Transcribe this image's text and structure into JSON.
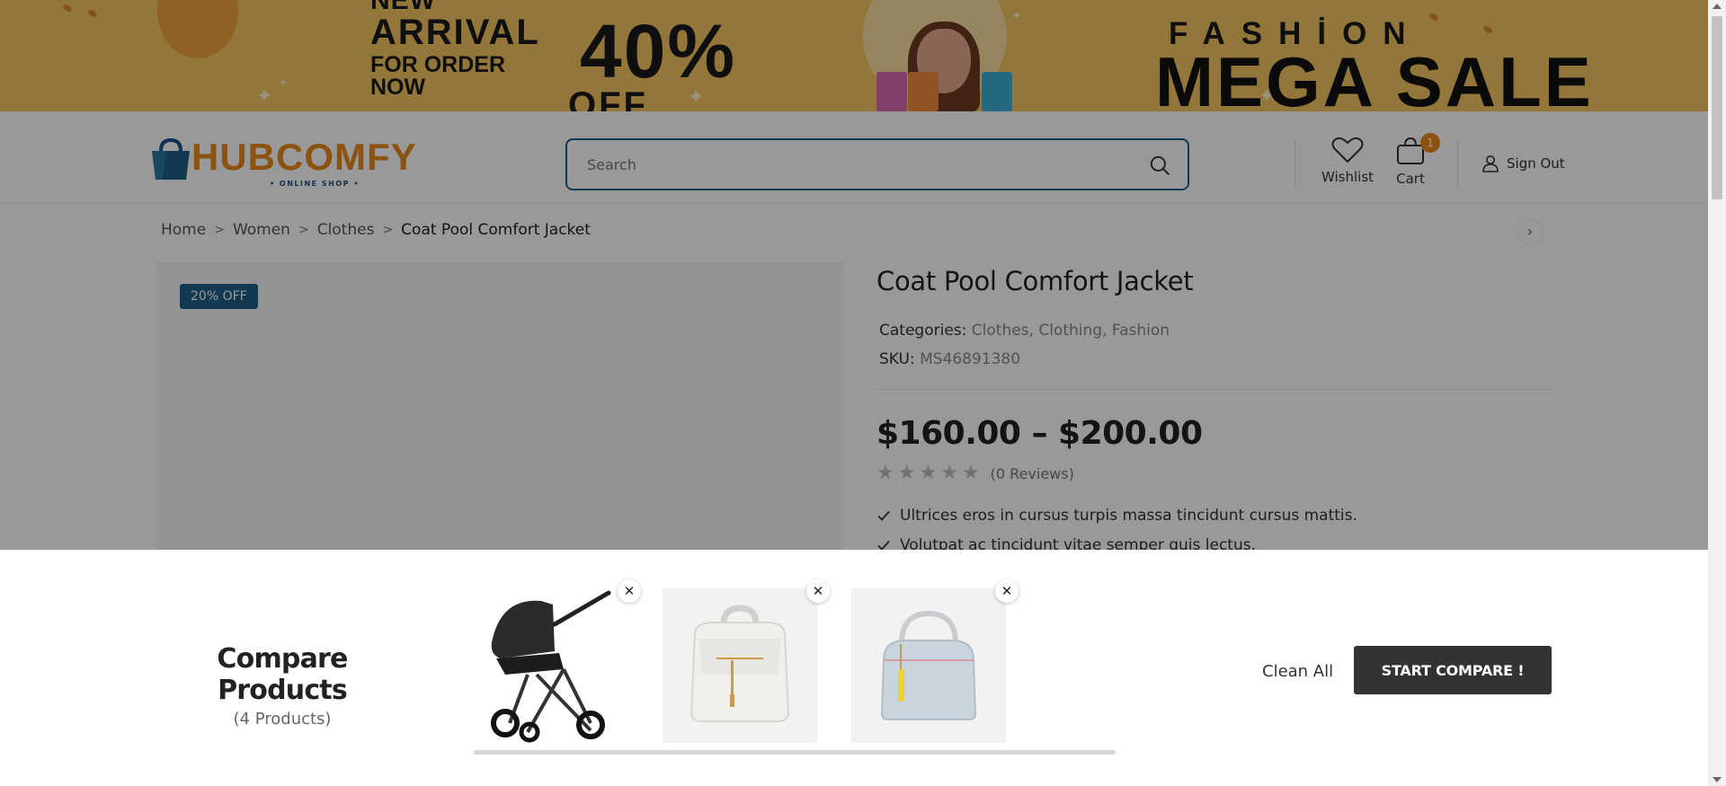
{
  "banner": {
    "new": "NEW",
    "arrival": "ARRIVAL",
    "for_order": "FOR ORDER",
    "now": "NOW",
    "discount": "40%",
    "off": "OFF",
    "fashion": "FASHİON",
    "mega_sale": "MEGA SALE"
  },
  "header": {
    "logo_text": "HUBCOMFY",
    "logo_sub": "• ONLINE SHOP •",
    "search_placeholder": "Search",
    "wishlist_label": "Wishlist",
    "cart_label": "Cart",
    "cart_count": "1",
    "signout_label": "Sign Out"
  },
  "breadcrumb": {
    "items": [
      "Home",
      "Women",
      "Clothes"
    ],
    "current": "Coat Pool Comfort Jacket"
  },
  "product": {
    "badge": "20% OFF",
    "title": "Coat Pool Comfort Jacket",
    "categories_label": "Categories:",
    "categories": "Clothes, Clothing, Fashion",
    "sku_label": "SKU:",
    "sku": "MS46891380",
    "price": "$160.00 – $200.00",
    "rating": 0,
    "reviews": "(0 Reviews)",
    "features": [
      "Ultrices eros in cursus turpis massa tincidunt cursus mattis.",
      "Volutpat ac tincidunt vitae semper quis lectus."
    ]
  },
  "compare": {
    "title": "Compare Products",
    "count": "(4 Products)",
    "items": [
      {
        "name": "stroller",
        "icon": "stroller-image"
      },
      {
        "name": "white backpack",
        "icon": "backpack-image"
      },
      {
        "name": "light blue handbag",
        "icon": "handbag-image"
      }
    ],
    "clean_all": "Clean All",
    "start_label": "START COMPARE !"
  },
  "colors": {
    "brand_orange": "#e8891e",
    "brand_blue": "#1d5f87",
    "banner_yellow": "#f6c55f",
    "button_dark": "#333333"
  }
}
